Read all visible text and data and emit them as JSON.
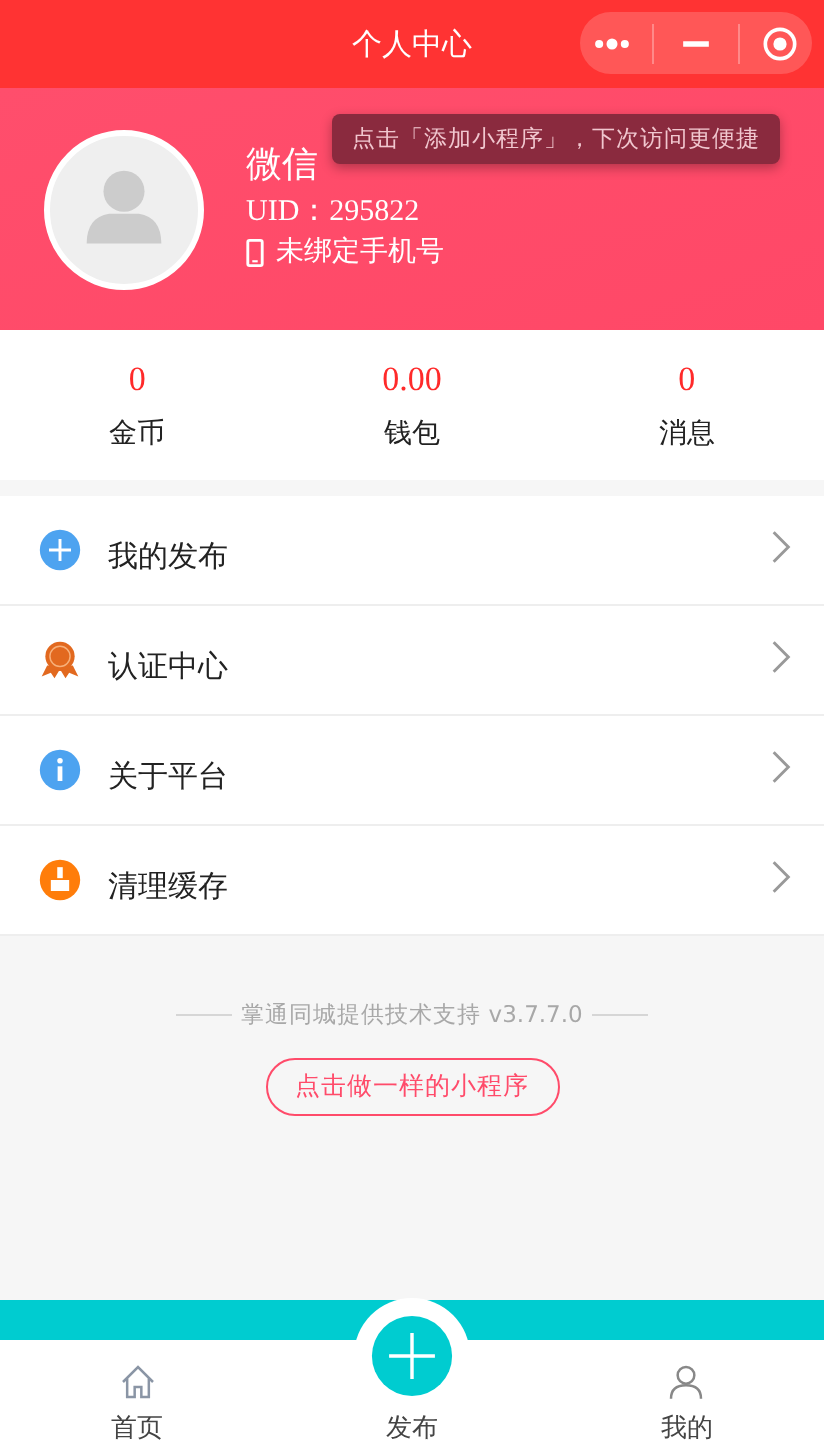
{
  "nav": {
    "title": "个人中心"
  },
  "tooltip": "点击「添加小程序」，下次访问更便捷",
  "profile": {
    "name": "微信",
    "uid": "UID：295822",
    "phone": "未绑定手机号"
  },
  "stats": [
    {
      "value": "0",
      "label": "金币"
    },
    {
      "value": "0.00",
      "label": "钱包"
    },
    {
      "value": "0",
      "label": "消息"
    }
  ],
  "menu": [
    {
      "kind": "plus",
      "label": "我的发布"
    },
    {
      "kind": "badge",
      "label": "认证中心"
    },
    {
      "kind": "info",
      "label": "关于平台"
    },
    {
      "kind": "broom",
      "label": "清理缓存"
    }
  ],
  "footer": {
    "credit": "掌通同城提供技术支持 v3.7.7.0",
    "button": "点击做一样的小程序"
  },
  "tabbar": [
    {
      "kind": "home",
      "label": "首页"
    },
    {
      "kind": "publish",
      "label": "发布"
    },
    {
      "kind": "user",
      "label": "我的"
    }
  ]
}
